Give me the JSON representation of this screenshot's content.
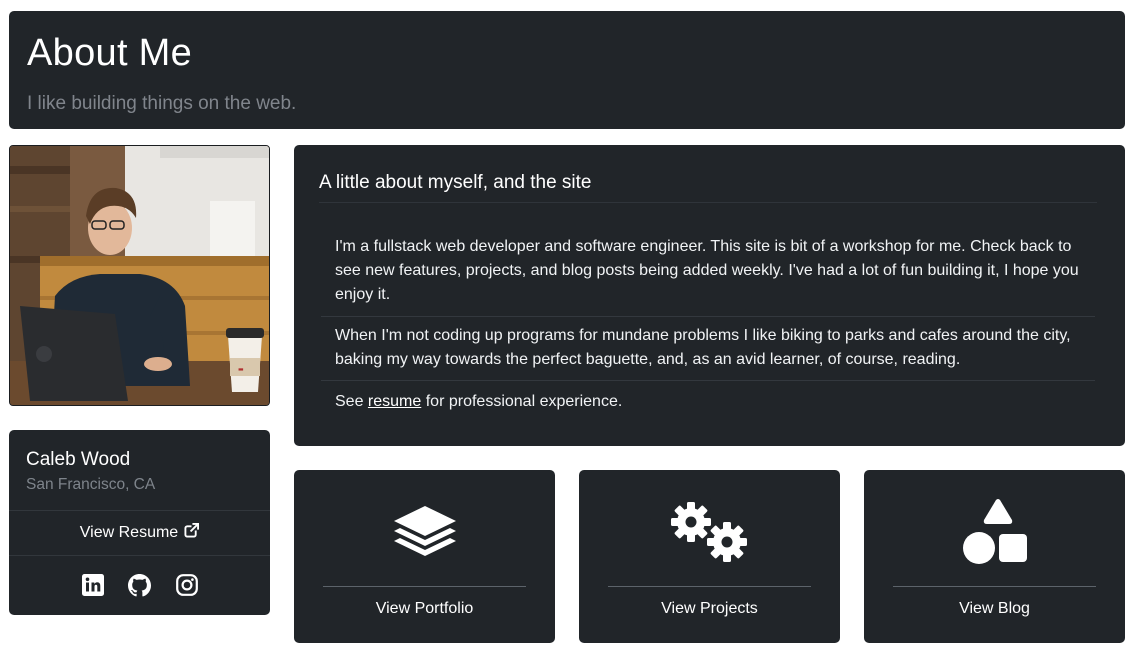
{
  "header": {
    "title": "About Me",
    "subtitle": "I like building things on the web."
  },
  "profile": {
    "name": "Caleb Wood",
    "location": "San Francisco, CA",
    "resume_label": "View Resume",
    "socials": [
      "linkedin-icon",
      "github-icon",
      "instagram-icon"
    ]
  },
  "about": {
    "heading": "A little about myself, and the site",
    "paragraph1": "I'm a fullstack web developer and software engineer. This site is bit of a workshop for me. Check back to see new features, projects, and blog posts being added weekly. I've had a lot of fun building it, I hope you enjoy it.",
    "paragraph2": "When I'm not coding up programs for mundane problems I like biking to parks and cafes around the city, baking my way towards the perfect baguette, and, as an avid learner, of course, reading.",
    "paragraph3_prefix": "See ",
    "paragraph3_link": "resume",
    "paragraph3_suffix": " for professional experience."
  },
  "tiles": [
    {
      "label": "View Portfolio",
      "icon": "layers-icon"
    },
    {
      "label": "View Projects",
      "icon": "gears-icon"
    },
    {
      "label": "View Blog",
      "icon": "shapes-icon"
    }
  ],
  "colors": {
    "card_bg": "#212529",
    "page_bg": "#ffffff",
    "muted_text": "#80858c"
  }
}
